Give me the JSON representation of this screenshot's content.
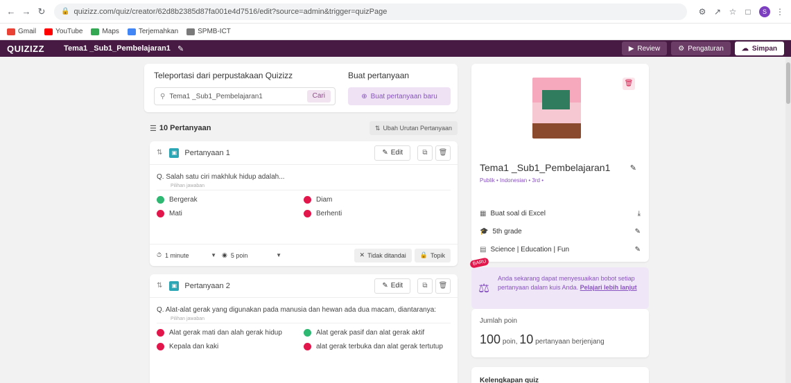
{
  "browser": {
    "url": "quizizz.com/quiz/creator/62d8b2385d87fa001e4d7516/edit?source=admin&trigger=quizPage",
    "profile_initial": "S",
    "bookmarks": [
      {
        "label": "Gmail",
        "color": "#ea4335"
      },
      {
        "label": "YouTube",
        "color": "#ff0000"
      },
      {
        "label": "Maps",
        "color": "#34a853"
      },
      {
        "label": "Terjemahkan",
        "color": "#4285f4"
      },
      {
        "label": "SPMB-ICT",
        "color": "#7a7a7a"
      }
    ]
  },
  "header": {
    "logo": "QUIZIZZ",
    "quiz_title": "Tema1 _Sub1_Pembelajaran1",
    "review_label": "Review",
    "settings_label": "Pengaturan",
    "save_label": "Simpan"
  },
  "teleport": {
    "title": "Teleportasi dari perpustakaan Quizizz",
    "search_value": "Tema1 _Sub1_Pembelajaran1",
    "search_button": "Cari",
    "create_title": "Buat pertanyaan",
    "create_button": "Buat pertanyaan baru"
  },
  "question_list": {
    "count_label": "10 Pertanyaan",
    "reorder_label": "Ubah Urutan Pertanyaan"
  },
  "questions": [
    {
      "number_label": "Pertanyaan 1",
      "edit_label": "Edit",
      "text": "Q. Salah satu ciri makhluk hidup adalah...",
      "answers_label": "Pilihan jawaban",
      "answers": [
        {
          "text": "Bergerak",
          "correct": true
        },
        {
          "text": "Diam",
          "correct": false
        },
        {
          "text": "Mati",
          "correct": false
        },
        {
          "text": "Berhenti",
          "correct": false
        }
      ],
      "time": "1 minute",
      "points": "5 poin",
      "tag_label": "Tidak ditandai",
      "topic_label": "Topik"
    },
    {
      "number_label": "Pertanyaan 2",
      "edit_label": "Edit",
      "text": "Q. Alat-alat gerak yang digunakan pada manusia dan hewan ada dua macam, diantaranya:",
      "answers_label": "Pilihan jawaban",
      "answers": [
        {
          "text": "Alat gerak mati dan alah gerak hidup",
          "correct": false
        },
        {
          "text": "Alat gerak pasif dan alat gerak aktif",
          "correct": true
        },
        {
          "text": "Kepala dan kaki",
          "correct": false
        },
        {
          "text": "alat gerak terbuka dan alat gerak tertutup",
          "correct": false
        }
      ],
      "time": "1 minute",
      "points": "5 poin",
      "tag_label": "Tidak ditandai",
      "topic_label": "Topik"
    }
  ],
  "quiz_info": {
    "title": "Tema1 _Sub1_Pembelajaran1",
    "meta": "Publik • Indonesian • 3rd •",
    "excel_label": "Buat soal di Excel",
    "grade_label": "5th grade",
    "subjects_label": "Science | Education | Fun"
  },
  "promo": {
    "badge": "BARU",
    "text": "Anda sekarang dapat menyesuaikan bobot setiap pertanyaan dalam kuis Anda.",
    "link": "Pelajari lebih lanjut"
  },
  "points_summary": {
    "label": "Jumlah poin",
    "total": "100",
    "total_unit": "poin,",
    "questions": "10",
    "questions_unit": "pertanyaan berjenjang"
  },
  "kelengkapan": {
    "label": "Kelengkapan quiz"
  }
}
